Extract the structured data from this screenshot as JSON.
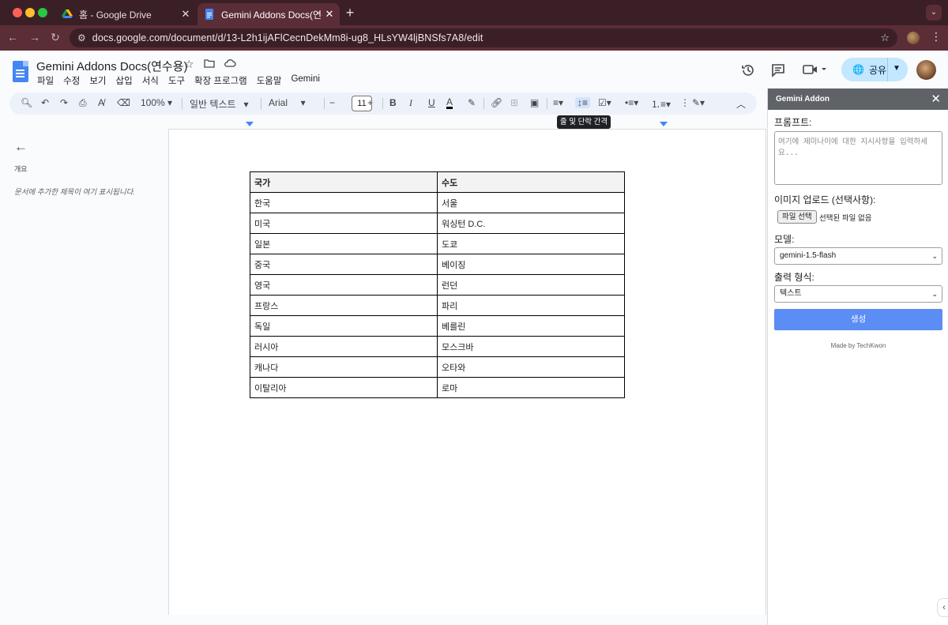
{
  "browser": {
    "tabs": [
      {
        "title": "홈 - Google Drive",
        "active": false
      },
      {
        "title": "Gemini Addons Docs(연수용)",
        "active": true
      }
    ],
    "url": "docs.google.com/document/d/13-L2h1ijAFlCecnDekMm8i-ug8_HLsYW4ljBNSfs7A8/edit"
  },
  "docs": {
    "title": "Gemini Addons Docs(연수용)",
    "menus": [
      "파일",
      "수정",
      "보기",
      "삽입",
      "서식",
      "도구",
      "확장 프로그램",
      "도움말",
      "Gemini"
    ],
    "share_label": "공유"
  },
  "toolbar": {
    "zoom": "100%",
    "style": "일반 텍스트",
    "font": "Arial",
    "font_size": "11",
    "tooltip": "줄 및 단락 간격"
  },
  "outline": {
    "label": "개요",
    "hint": "문서에 추가한 제목이 여기 표시됩니다."
  },
  "table": {
    "headers": [
      "국가",
      "수도"
    ],
    "rows": [
      [
        "한국",
        "서울"
      ],
      [
        "미국",
        "워싱턴 D.C."
      ],
      [
        "일본",
        "도쿄"
      ],
      [
        "중국",
        "베이징"
      ],
      [
        "영국",
        "런던"
      ],
      [
        "프랑스",
        "파리"
      ],
      [
        "독일",
        "베를린"
      ],
      [
        "러시아",
        "모스크바"
      ],
      [
        "캐나다",
        "오타와"
      ],
      [
        "이탈리아",
        "로마"
      ]
    ]
  },
  "addon": {
    "title": "Gemini Addon",
    "prompt_label": "프롬프트:",
    "prompt_placeholder": "여기에 제미나이에 대한 지시사항을 입력하세요...",
    "image_label": "이미지 업로드 (선택사항):",
    "file_button": "파일 선택",
    "file_status": "선택된 파일 없음",
    "model_label": "모델:",
    "model_value": "gemini-1.5-flash",
    "format_label": "출력 형식:",
    "format_value": "텍스트",
    "generate_label": "생성",
    "credit": "Made by TechKwon"
  },
  "colors": {
    "tabbar": "#3b1f27",
    "addressbar": "#5a2d37",
    "share": "#c2e7ff",
    "generate": "#5b8df5",
    "panel_header": "#5f6368"
  }
}
